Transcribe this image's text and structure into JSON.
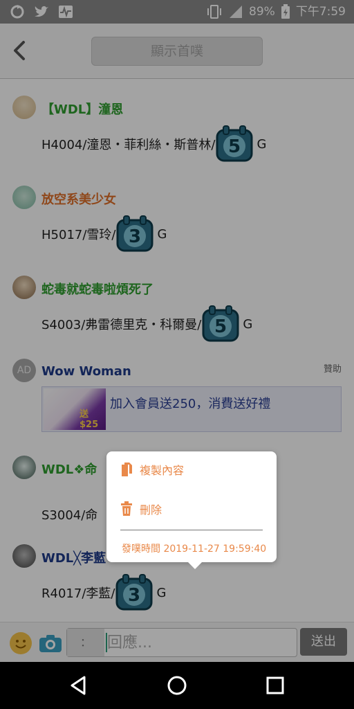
{
  "status_bar": {
    "battery": "89%",
    "time": "下午7:59",
    "icons": [
      "sync-icon",
      "twitter-icon",
      "activity-icon",
      "vibrate-icon",
      "signal-icon",
      "battery-icon"
    ]
  },
  "header": {
    "back_icon": "back-chevron-icon",
    "title_button": "顯示首噗"
  },
  "posts": [
    {
      "name": "【WDL】潼恩",
      "name_color": "#2f9e2f",
      "text": "H4004/潼恩・菲利絲・斯普林/",
      "badge": "5",
      "suffix": "G"
    },
    {
      "name": "放空系美少女",
      "name_color": "#e0702a",
      "text": "H5017/雪玲/",
      "badge": "3",
      "suffix": "G"
    },
    {
      "name": "蛇毒就蛇毒啦煩死了",
      "name_color": "#2f9e2f",
      "text": "S4003/弗雷德里克・科爾曼/",
      "badge": "5",
      "suffix": "G"
    },
    {
      "name": "WDL❖命",
      "name_color": "#2f9e2f",
      "text": "S3004/命"
    },
    {
      "name": "WDL╳李藍",
      "name_color": "#1e3a8a",
      "text": "R4017/李藍/",
      "badge": "3",
      "suffix": "G"
    }
  ],
  "ad": {
    "avatar_label": "AD",
    "name": "Wow Woman",
    "sponsor_label": "贊助",
    "headline": "加入會員送250，消費送好禮",
    "thumb_text": "送$25"
  },
  "context_menu": {
    "copy_label": "複製內容",
    "delete_label": "刪除",
    "post_time": "發噗時間 2019-11-27 19:59:40",
    "accent_color": "#e9894a"
  },
  "composer": {
    "qualifier": "：",
    "placeholder": "回應...",
    "send_label": "送出"
  }
}
